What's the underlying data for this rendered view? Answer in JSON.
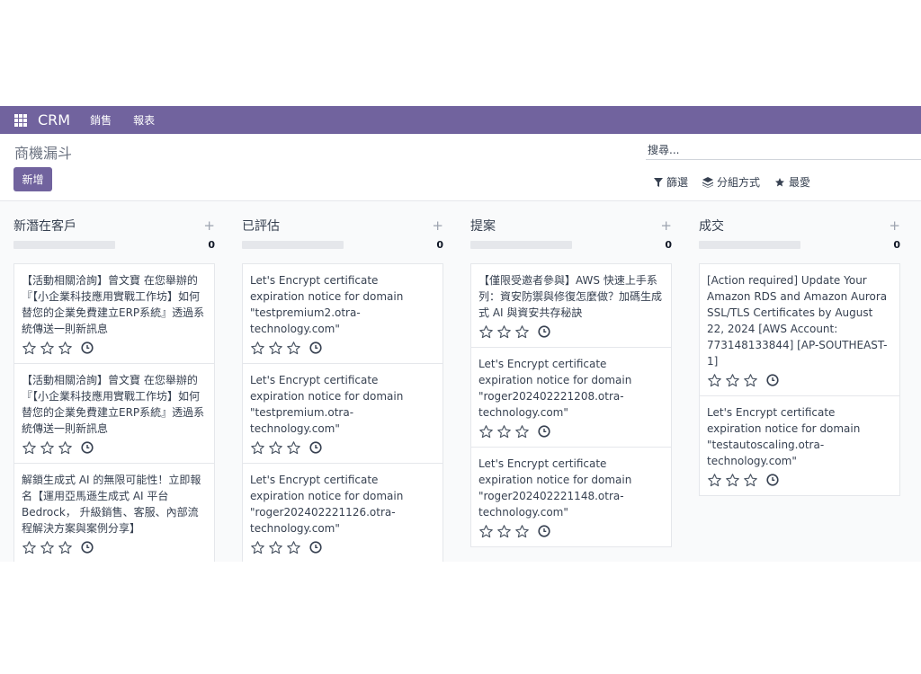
{
  "navbar": {
    "brand": "CRM",
    "menu": [
      "銷售",
      "報表"
    ]
  },
  "control": {
    "page_title": "商機漏斗",
    "new_button": "新增",
    "search_placeholder": "搜尋...",
    "filter_label": "篩選",
    "group_label": "分組方式",
    "favorite_label": "最愛"
  },
  "columns": [
    {
      "title": "新潛在客戶",
      "count": "0",
      "cards": [
        {
          "title": "【活動相關洽詢】曾文寶 在您舉辦的『【小企業科技應用實戰工作坊】如何替您的企業免費建立ERP系統』透過系統傳送一則新訊息"
        },
        {
          "title": "【活動相關洽詢】曾文寶 在您舉辦的『【小企業科技應用實戰工作坊】如何替您的企業免費建立ERP系統』透過系統傳送一則新訊息"
        },
        {
          "title": "解鎖生成式 AI 的無限可能性！立即報名【運用亞馬遜生成式 AI 平台 Bedrock， 升級銷售、客服、內部流程解決方案與案例分享】"
        }
      ]
    },
    {
      "title": "已評估",
      "count": "0",
      "cards": [
        {
          "title": "Let's Encrypt certificate expiration notice for domain \"testpremium2.otra-technology.com\""
        },
        {
          "title": "Let's Encrypt certificate expiration notice for domain \"testpremium.otra-technology.com\""
        },
        {
          "title": "Let's Encrypt certificate expiration notice for domain \"roger202402221126.otra-technology.com\""
        }
      ]
    },
    {
      "title": "提案",
      "count": "0",
      "cards": [
        {
          "title": "【僅限受邀者參與】AWS 快速上手系列：資安防禦與修復怎麼做？加碼生成式 AI 與資安共存秘訣"
        },
        {
          "title": "Let's Encrypt certificate expiration notice for domain \"roger202402221208.otra-technology.com\""
        },
        {
          "title": "Let's Encrypt certificate expiration notice for domain \"roger202402221148.otra-technology.com\""
        }
      ]
    },
    {
      "title": "成交",
      "count": "0",
      "cards": [
        {
          "title": "[Action required] Update Your Amazon RDS and Amazon Aurora SSL/TLS Certificates by August 22, 2024 [AWS Account: 773148133844] [AP-SOUTHEAST-1]"
        },
        {
          "title": "Let's Encrypt certificate expiration notice for domain \"testautoscaling.otra-technology.com\""
        }
      ]
    }
  ]
}
